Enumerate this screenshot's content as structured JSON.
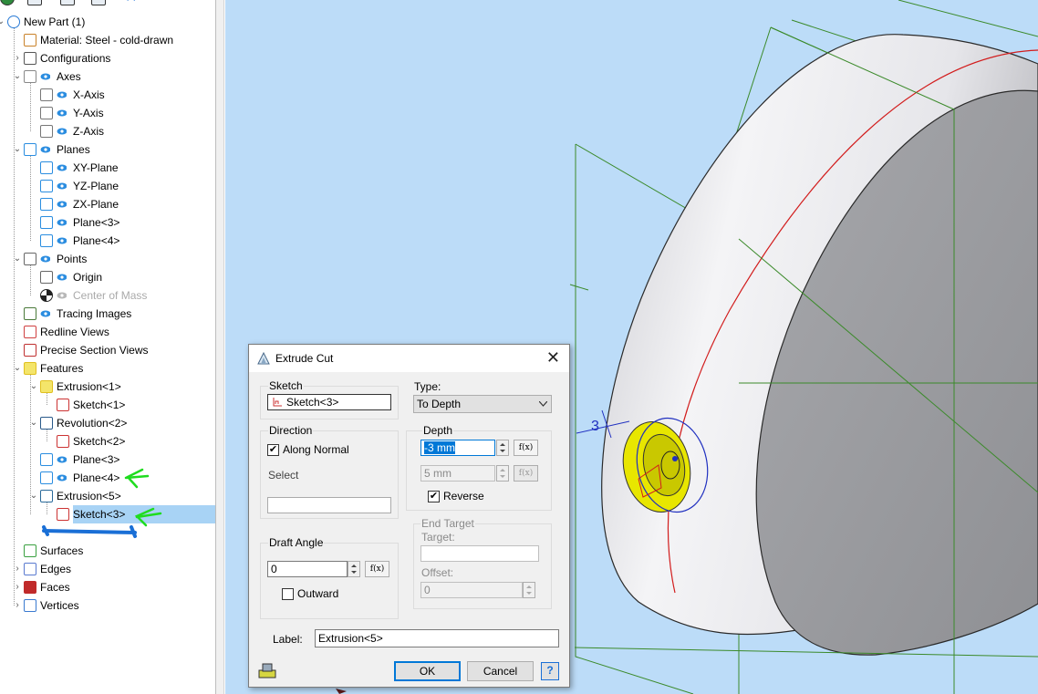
{
  "tree": {
    "items": [
      {
        "label": "New Part (1)",
        "icon": "part-icon"
      },
      {
        "label": "Material: Steel - cold-drawn",
        "icon": "material-icon"
      },
      {
        "label": "Configurations",
        "icon": "configurations-icon"
      },
      {
        "label": "Axes",
        "icon": "axes-icon"
      },
      {
        "label": "X-Axis",
        "icon": "axis-icon"
      },
      {
        "label": "Y-Axis",
        "icon": "axis-icon"
      },
      {
        "label": "Z-Axis",
        "icon": "axis-icon"
      },
      {
        "label": "Planes",
        "icon": "planes-icon"
      },
      {
        "label": "XY-Plane",
        "icon": "plane-icon"
      },
      {
        "label": "YZ-Plane",
        "icon": "plane-icon"
      },
      {
        "label": "ZX-Plane",
        "icon": "plane-icon"
      },
      {
        "label": "Plane<3>",
        "icon": "plane-icon"
      },
      {
        "label": "Plane<4>",
        "icon": "plane-icon"
      },
      {
        "label": "Points",
        "icon": "points-icon"
      },
      {
        "label": "Origin",
        "icon": "origin-icon"
      },
      {
        "label": "Center of Mass",
        "icon": "center-of-mass-icon"
      },
      {
        "label": "Tracing Images",
        "icon": "tracing-images-icon"
      },
      {
        "label": "Redline Views",
        "icon": "redline-views-icon"
      },
      {
        "label": "Precise Section Views",
        "icon": "section-views-icon"
      },
      {
        "label": "Features",
        "icon": "features-icon"
      },
      {
        "label": "Extrusion<1>",
        "icon": "extrusion-icon"
      },
      {
        "label": "Sketch<1>",
        "icon": "sketch-icon"
      },
      {
        "label": "Revolution<2>",
        "icon": "revolution-icon"
      },
      {
        "label": "Sketch<2>",
        "icon": "sketch-icon"
      },
      {
        "label": "Plane<3>",
        "icon": "plane-icon"
      },
      {
        "label": "Plane<4>",
        "icon": "plane-icon"
      },
      {
        "label": "Extrusion<5>",
        "icon": "extrusion-cut-icon"
      },
      {
        "label": "Sketch<3>",
        "icon": "sketch-icon"
      },
      {
        "label": "Surfaces",
        "icon": "surfaces-icon"
      },
      {
        "label": "Edges",
        "icon": "edges-icon"
      },
      {
        "label": "Faces",
        "icon": "faces-icon"
      },
      {
        "label": "Vertices",
        "icon": "vertices-icon"
      }
    ]
  },
  "dialog": {
    "title": "Extrude Cut",
    "sketch_group": "Sketch",
    "sketch_value": "Sketch<3>",
    "direction_group": "Direction",
    "along_normal_label": "Along Normal",
    "along_normal_checked": true,
    "select_label": "Select",
    "select_value": "",
    "draft_angle_group": "Draft Angle",
    "draft_angle_value": "0",
    "outward_label": "Outward",
    "outward_checked": false,
    "type_label": "Type:",
    "type_value": "To Depth",
    "depth_group": "Depth",
    "depth_value": "-3 mm",
    "depth2_value": "5 mm",
    "fx_label": "f(x)",
    "reverse_label": "Reverse",
    "reverse_checked": true,
    "end_target_group": "End Target",
    "target_label": "Target:",
    "target_value": "",
    "offset_label": "Offset:",
    "offset_value": "0",
    "label_label": "Label:",
    "label_value": "Extrusion<5>",
    "ok_label": "OK",
    "cancel_label": "Cancel",
    "help_label": "?"
  },
  "viewport": {
    "dimension_text": "3"
  },
  "colors": {
    "selection": "#a8d3f5",
    "viewport_bg": "#bcdcf8",
    "annotation_green": "#1fdc1f",
    "annotation_blue": "#1a6fd6",
    "eye_blue": "#2b8de0"
  }
}
